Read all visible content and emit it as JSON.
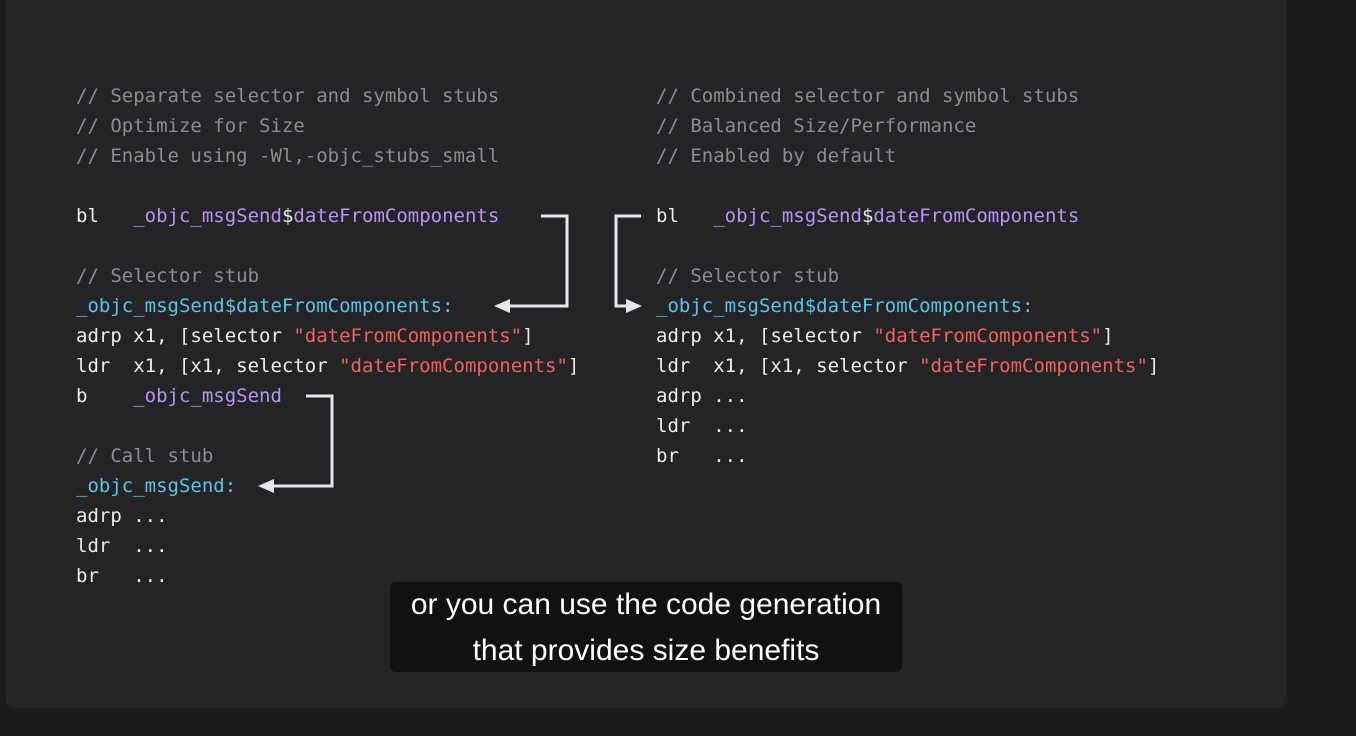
{
  "left": {
    "comment1": "// Separate selector and symbol stubs",
    "comment2": "// Optimize for Size",
    "comment3": "// Enable using -Wl,-objc_stubs_small",
    "bl_op": "bl",
    "bl_target": "_objc_msgSend",
    "bl_dollar": "$",
    "bl_sel": "dateFromComponents",
    "sel_stub_comment": "// Selector stub",
    "sel_label": "_objc_msgSend$dateFromComponents:",
    "adrp_prefix": "adrp x1, [selector ",
    "adrp_str": "\"dateFromComponents\"",
    "adrp_suffix": "]",
    "ldr_prefix": "ldr  x1, [x1, selector ",
    "ldr_str": "\"dateFromComponents\"",
    "ldr_suffix": "]",
    "b_op": "b",
    "b_target": "_objc_msgSend",
    "call_stub_comment": "// Call stub",
    "call_label": "_objc_msgSend:",
    "call_lines": [
      "adrp ...",
      "ldr  ...",
      "br   ..."
    ]
  },
  "right": {
    "comment1": "// Combined selector and symbol stubs",
    "comment2": "// Balanced Size/Performance",
    "comment3": "// Enabled by default",
    "bl_op": "bl",
    "bl_target": "_objc_msgSend",
    "bl_dollar": "$",
    "bl_sel": "dateFromComponents",
    "sel_stub_comment": "// Selector stub",
    "sel_label": "_objc_msgSend$dateFromComponents:",
    "adrp_prefix": "adrp x1, [selector ",
    "adrp_str": "\"dateFromComponents\"",
    "adrp_suffix": "]",
    "ldr_prefix": "ldr  x1, [x1, selector ",
    "ldr_str": "\"dateFromComponents\"",
    "ldr_suffix": "]",
    "tail_lines": [
      "adrp ...",
      "ldr  ...",
      "br   ..."
    ]
  },
  "caption": {
    "line1": "or you can use the code generation",
    "line2": "that provides size benefits"
  },
  "colors": {
    "background": "#1b1b1d",
    "slide": "#242427",
    "comment": "#8c8c93",
    "label": "#5ec4e6",
    "symbol": "#b894f4",
    "string": "#f0625c",
    "text": "#ececec",
    "arrow": "#e6e6ea"
  }
}
